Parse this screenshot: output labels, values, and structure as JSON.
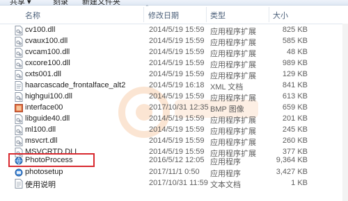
{
  "toolbar": {
    "items": [
      "共享 ▾",
      "刻录",
      "新建文件夹"
    ]
  },
  "columns": {
    "name": "名称",
    "date": "修改日期",
    "type": "类型",
    "size": "大小"
  },
  "files": [
    {
      "name": "cv100.dll",
      "date": "2014/5/19 15:59",
      "type": "应用程序扩展",
      "size": "825 KB",
      "icon": "dll-file-icon"
    },
    {
      "name": "cvaux100.dll",
      "date": "2014/5/19 15:59",
      "type": "应用程序扩展",
      "size": "585 KB",
      "icon": "dll-file-icon"
    },
    {
      "name": "cvcam100.dll",
      "date": "2014/5/19 15:59",
      "type": "应用程序扩展",
      "size": "48 KB",
      "icon": "dll-file-icon"
    },
    {
      "name": "cxcore100.dll",
      "date": "2014/5/19 15:59",
      "type": "应用程序扩展",
      "size": "989 KB",
      "icon": "dll-file-icon"
    },
    {
      "name": "cxts001.dll",
      "date": "2014/5/19 15:59",
      "type": "应用程序扩展",
      "size": "129 KB",
      "icon": "dll-file-icon"
    },
    {
      "name": "haarcascade_frontalface_alt2",
      "date": "2014/5/19 16:18",
      "type": "XML 文档",
      "size": "841 KB",
      "icon": "xml-file-icon"
    },
    {
      "name": "highgui100.dll",
      "date": "2014/5/19 15:59",
      "type": "应用程序扩展",
      "size": "613 KB",
      "icon": "dll-file-icon"
    },
    {
      "name": "interface00",
      "date": "2017/10/31 12:35",
      "type": "BMP 图像",
      "size": "659 KB",
      "icon": "bmp-image-icon"
    },
    {
      "name": "libguide40.dll",
      "date": "2014/5/19 15:59",
      "type": "应用程序扩展",
      "size": "201 KB",
      "icon": "dll-file-icon"
    },
    {
      "name": "ml100.dll",
      "date": "2014/5/19 15:59",
      "type": "应用程序扩展",
      "size": "245 KB",
      "icon": "dll-file-icon"
    },
    {
      "name": "msvcrt.dll",
      "date": "2014/5/19 15:59",
      "type": "应用程序扩展",
      "size": "260 KB",
      "icon": "dll-file-icon"
    },
    {
      "name": "MSVCRTD.DLL",
      "date": "2014/5/19 15:59",
      "type": "应用程序扩展",
      "size": "377 KB",
      "icon": "dll-file-icon"
    },
    {
      "name": "PhotoProcess",
      "date": "2016/5/12 12:05",
      "type": "应用程序",
      "size": "9,364 KB",
      "icon": "app-globe-icon"
    },
    {
      "name": "photosetup",
      "date": "2017/11/1 0:50",
      "type": "应用程序",
      "size": "3,427 KB",
      "icon": "setup-app-icon"
    },
    {
      "name": "使用说明",
      "date": "2017/10/31 11:59",
      "type": "文本文档",
      "size": "1 KB",
      "icon": "text-file-icon"
    }
  ],
  "colors": {
    "highlight": "#d8282e",
    "header_text": "#4c607a"
  }
}
